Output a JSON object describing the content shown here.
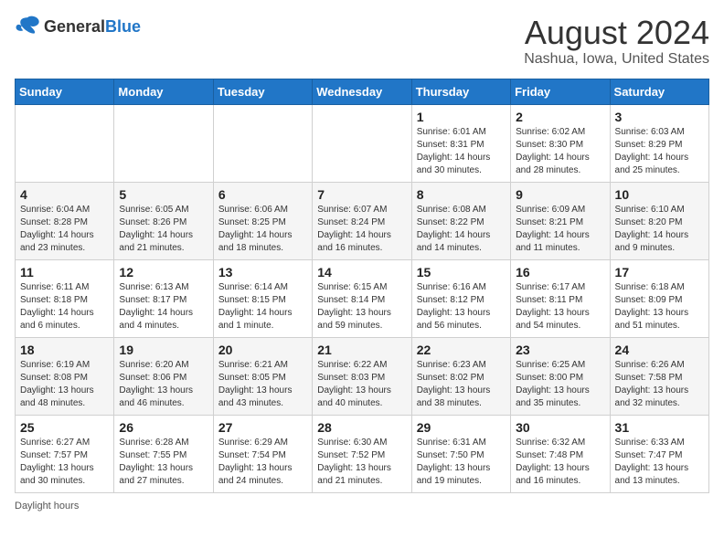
{
  "header": {
    "logo_general": "General",
    "logo_blue": "Blue",
    "main_title": "August 2024",
    "subtitle": "Nashua, Iowa, United States"
  },
  "calendar": {
    "days_of_week": [
      "Sunday",
      "Monday",
      "Tuesday",
      "Wednesday",
      "Thursday",
      "Friday",
      "Saturday"
    ],
    "weeks": [
      [
        {
          "day": "",
          "sunrise": "",
          "sunset": "",
          "daylight": ""
        },
        {
          "day": "",
          "sunrise": "",
          "sunset": "",
          "daylight": ""
        },
        {
          "day": "",
          "sunrise": "",
          "sunset": "",
          "daylight": ""
        },
        {
          "day": "",
          "sunrise": "",
          "sunset": "",
          "daylight": ""
        },
        {
          "day": "1",
          "sunrise": "Sunrise: 6:01 AM",
          "sunset": "Sunset: 8:31 PM",
          "daylight": "Daylight: 14 hours and 30 minutes."
        },
        {
          "day": "2",
          "sunrise": "Sunrise: 6:02 AM",
          "sunset": "Sunset: 8:30 PM",
          "daylight": "Daylight: 14 hours and 28 minutes."
        },
        {
          "day": "3",
          "sunrise": "Sunrise: 6:03 AM",
          "sunset": "Sunset: 8:29 PM",
          "daylight": "Daylight: 14 hours and 25 minutes."
        }
      ],
      [
        {
          "day": "4",
          "sunrise": "Sunrise: 6:04 AM",
          "sunset": "Sunset: 8:28 PM",
          "daylight": "Daylight: 14 hours and 23 minutes."
        },
        {
          "day": "5",
          "sunrise": "Sunrise: 6:05 AM",
          "sunset": "Sunset: 8:26 PM",
          "daylight": "Daylight: 14 hours and 21 minutes."
        },
        {
          "day": "6",
          "sunrise": "Sunrise: 6:06 AM",
          "sunset": "Sunset: 8:25 PM",
          "daylight": "Daylight: 14 hours and 18 minutes."
        },
        {
          "day": "7",
          "sunrise": "Sunrise: 6:07 AM",
          "sunset": "Sunset: 8:24 PM",
          "daylight": "Daylight: 14 hours and 16 minutes."
        },
        {
          "day": "8",
          "sunrise": "Sunrise: 6:08 AM",
          "sunset": "Sunset: 8:22 PM",
          "daylight": "Daylight: 14 hours and 14 minutes."
        },
        {
          "day": "9",
          "sunrise": "Sunrise: 6:09 AM",
          "sunset": "Sunset: 8:21 PM",
          "daylight": "Daylight: 14 hours and 11 minutes."
        },
        {
          "day": "10",
          "sunrise": "Sunrise: 6:10 AM",
          "sunset": "Sunset: 8:20 PM",
          "daylight": "Daylight: 14 hours and 9 minutes."
        }
      ],
      [
        {
          "day": "11",
          "sunrise": "Sunrise: 6:11 AM",
          "sunset": "Sunset: 8:18 PM",
          "daylight": "Daylight: 14 hours and 6 minutes."
        },
        {
          "day": "12",
          "sunrise": "Sunrise: 6:13 AM",
          "sunset": "Sunset: 8:17 PM",
          "daylight": "Daylight: 14 hours and 4 minutes."
        },
        {
          "day": "13",
          "sunrise": "Sunrise: 6:14 AM",
          "sunset": "Sunset: 8:15 PM",
          "daylight": "Daylight: 14 hours and 1 minute."
        },
        {
          "day": "14",
          "sunrise": "Sunrise: 6:15 AM",
          "sunset": "Sunset: 8:14 PM",
          "daylight": "Daylight: 13 hours and 59 minutes."
        },
        {
          "day": "15",
          "sunrise": "Sunrise: 6:16 AM",
          "sunset": "Sunset: 8:12 PM",
          "daylight": "Daylight: 13 hours and 56 minutes."
        },
        {
          "day": "16",
          "sunrise": "Sunrise: 6:17 AM",
          "sunset": "Sunset: 8:11 PM",
          "daylight": "Daylight: 13 hours and 54 minutes."
        },
        {
          "day": "17",
          "sunrise": "Sunrise: 6:18 AM",
          "sunset": "Sunset: 8:09 PM",
          "daylight": "Daylight: 13 hours and 51 minutes."
        }
      ],
      [
        {
          "day": "18",
          "sunrise": "Sunrise: 6:19 AM",
          "sunset": "Sunset: 8:08 PM",
          "daylight": "Daylight: 13 hours and 48 minutes."
        },
        {
          "day": "19",
          "sunrise": "Sunrise: 6:20 AM",
          "sunset": "Sunset: 8:06 PM",
          "daylight": "Daylight: 13 hours and 46 minutes."
        },
        {
          "day": "20",
          "sunrise": "Sunrise: 6:21 AM",
          "sunset": "Sunset: 8:05 PM",
          "daylight": "Daylight: 13 hours and 43 minutes."
        },
        {
          "day": "21",
          "sunrise": "Sunrise: 6:22 AM",
          "sunset": "Sunset: 8:03 PM",
          "daylight": "Daylight: 13 hours and 40 minutes."
        },
        {
          "day": "22",
          "sunrise": "Sunrise: 6:23 AM",
          "sunset": "Sunset: 8:02 PM",
          "daylight": "Daylight: 13 hours and 38 minutes."
        },
        {
          "day": "23",
          "sunrise": "Sunrise: 6:25 AM",
          "sunset": "Sunset: 8:00 PM",
          "daylight": "Daylight: 13 hours and 35 minutes."
        },
        {
          "day": "24",
          "sunrise": "Sunrise: 6:26 AM",
          "sunset": "Sunset: 7:58 PM",
          "daylight": "Daylight: 13 hours and 32 minutes."
        }
      ],
      [
        {
          "day": "25",
          "sunrise": "Sunrise: 6:27 AM",
          "sunset": "Sunset: 7:57 PM",
          "daylight": "Daylight: 13 hours and 30 minutes."
        },
        {
          "day": "26",
          "sunrise": "Sunrise: 6:28 AM",
          "sunset": "Sunset: 7:55 PM",
          "daylight": "Daylight: 13 hours and 27 minutes."
        },
        {
          "day": "27",
          "sunrise": "Sunrise: 6:29 AM",
          "sunset": "Sunset: 7:54 PM",
          "daylight": "Daylight: 13 hours and 24 minutes."
        },
        {
          "day": "28",
          "sunrise": "Sunrise: 6:30 AM",
          "sunset": "Sunset: 7:52 PM",
          "daylight": "Daylight: 13 hours and 21 minutes."
        },
        {
          "day": "29",
          "sunrise": "Sunrise: 6:31 AM",
          "sunset": "Sunset: 7:50 PM",
          "daylight": "Daylight: 13 hours and 19 minutes."
        },
        {
          "day": "30",
          "sunrise": "Sunrise: 6:32 AM",
          "sunset": "Sunset: 7:48 PM",
          "daylight": "Daylight: 13 hours and 16 minutes."
        },
        {
          "day": "31",
          "sunrise": "Sunrise: 6:33 AM",
          "sunset": "Sunset: 7:47 PM",
          "daylight": "Daylight: 13 hours and 13 minutes."
        }
      ]
    ]
  },
  "footer": {
    "note": "Daylight hours"
  }
}
